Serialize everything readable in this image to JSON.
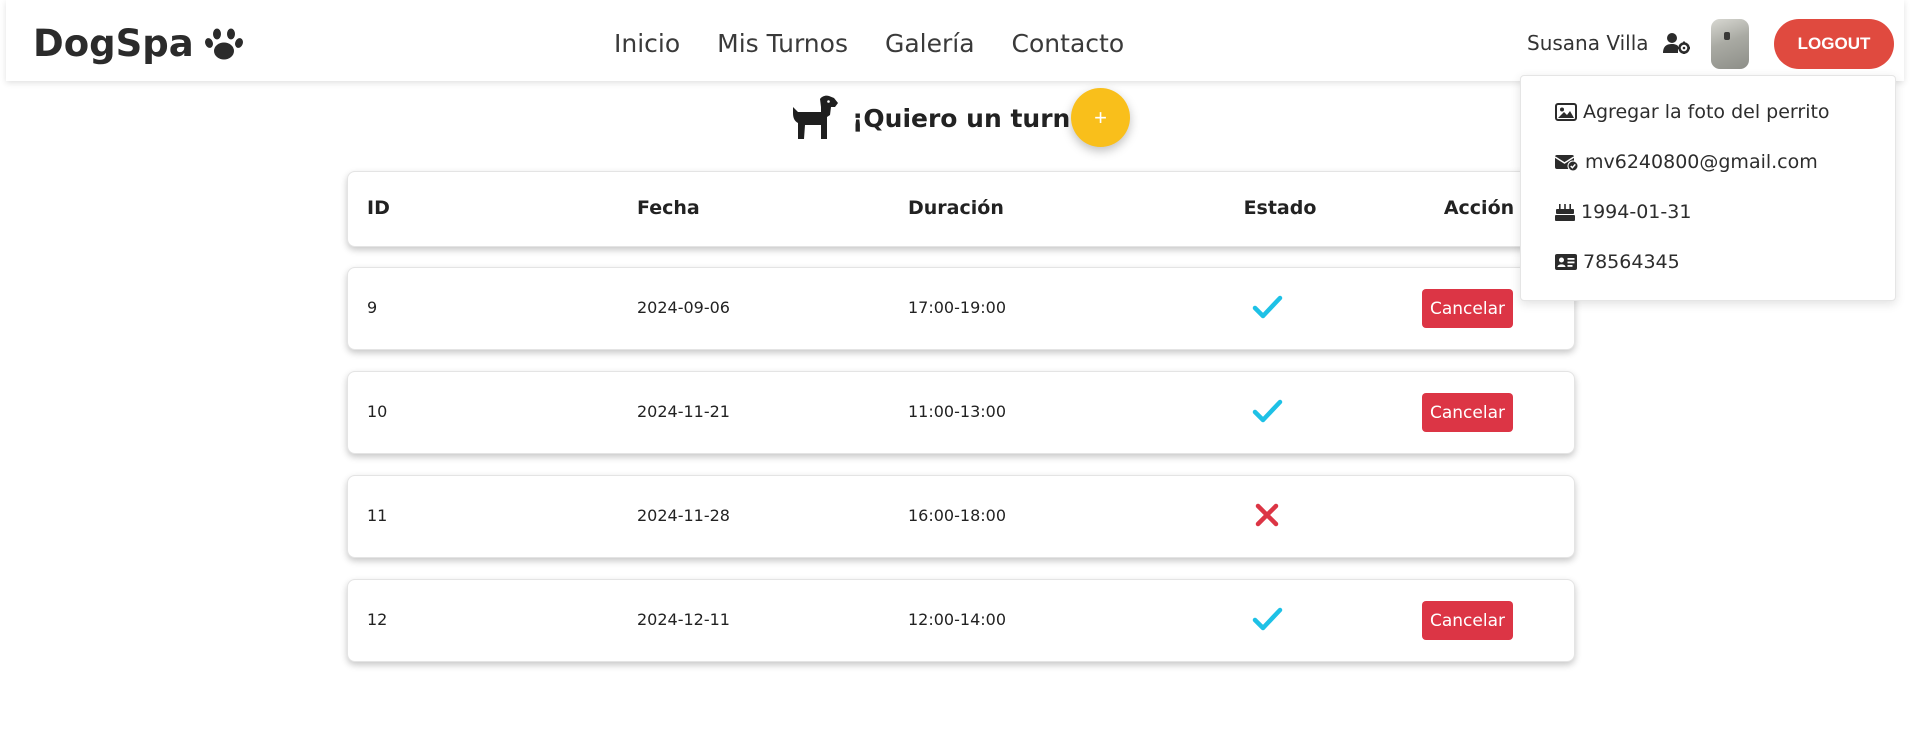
{
  "brand": {
    "name": "DogSpa",
    "logo_icon": "paw-icon"
  },
  "nav": {
    "items": [
      {
        "label": "Inicio"
      },
      {
        "label": "Mis Turnos"
      },
      {
        "label": "Galería"
      },
      {
        "label": "Contacto"
      }
    ]
  },
  "user": {
    "name": "Susana Villa",
    "settings_icon": "user-gear-icon",
    "logout_label": "LOGOUT"
  },
  "dropdown": {
    "items": [
      {
        "icon": "image-icon",
        "label": "Agregar la foto del perrito"
      },
      {
        "icon": "envelope-check-icon",
        "label": "mv6240800@gmail.com"
      },
      {
        "icon": "birthday-cake-icon",
        "label": "1994-01-31"
      },
      {
        "icon": "id-card-icon",
        "label": "78564345"
      }
    ]
  },
  "hero": {
    "title": "¡Quiero un turno!",
    "add_label": "+",
    "icon": "dog-icon"
  },
  "table": {
    "headers": {
      "id": "ID",
      "fecha": "Fecha",
      "duracion": "Duración",
      "estado": "Estado",
      "accion": "Acción"
    },
    "rows": [
      {
        "id": "9",
        "fecha": "2024-09-06",
        "duracion": "17:00-19:00",
        "estado": "confirmed",
        "action": "Cancelar"
      },
      {
        "id": "10",
        "fecha": "2024-11-21",
        "duracion": "11:00-13:00",
        "estado": "confirmed",
        "action": "Cancelar"
      },
      {
        "id": "11",
        "fecha": "2024-11-28",
        "duracion": "16:00-18:00",
        "estado": "cancelled",
        "action": ""
      },
      {
        "id": "12",
        "fecha": "2024-12-11",
        "duracion": "12:00-14:00",
        "estado": "confirmed",
        "action": "Cancelar"
      }
    ]
  },
  "colors": {
    "confirmed": "#1ec1e6",
    "cancelled": "#dc3545",
    "logout": "#e04a3f",
    "add": "#f9bf1b"
  }
}
